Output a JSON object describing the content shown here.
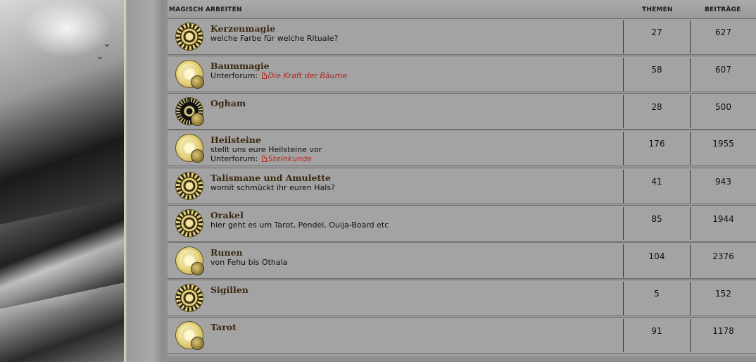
{
  "category": {
    "title": "MAGISCH ARBEITEN",
    "col_topics": "THEMEN",
    "col_posts": "BEITRÄGE"
  },
  "sub_label": "Unterforum:",
  "forums": [
    {
      "name": "Kerzenmagie",
      "desc": "welche Farbe für welche Rituale?",
      "sub": "",
      "topics": "27",
      "posts": "627",
      "icon": "patterned-medallion-icon"
    },
    {
      "name": "Baummagie",
      "desc": "",
      "sub": "Die Kraft der Bäume",
      "topics": "58",
      "posts": "607",
      "icon": "glowing-medallion-icon"
    },
    {
      "name": "Ogham",
      "desc": "",
      "sub": "",
      "topics": "28",
      "posts": "500",
      "icon": "dark-medallion-icon"
    },
    {
      "name": "Heilsteine",
      "desc": "stellt uns eure Heilsteine vor",
      "sub": "Steinkunde",
      "topics": "176",
      "posts": "1955",
      "icon": "glowing-medallion-icon"
    },
    {
      "name": "Talismane und Amulette",
      "desc": "womit schmückt ihr euren Hals?",
      "sub": "",
      "topics": "41",
      "posts": "943",
      "icon": "patterned-medallion-icon"
    },
    {
      "name": "Orakel",
      "desc": "hier geht es um Tarot, Pendel, Ouija-Board etc",
      "sub": "",
      "topics": "85",
      "posts": "1944",
      "icon": "patterned-medallion-icon"
    },
    {
      "name": "Runen",
      "desc": "von Fehu bis Othala",
      "sub": "",
      "topics": "104",
      "posts": "2376",
      "icon": "glowing-medallion-icon"
    },
    {
      "name": "Sigillen",
      "desc": "",
      "sub": "",
      "topics": "5",
      "posts": "152",
      "icon": "patterned-medallion-icon"
    },
    {
      "name": "Tarot",
      "desc": "",
      "sub": "",
      "topics": "91",
      "posts": "1178",
      "icon": "glowing-medallion-icon"
    }
  ]
}
